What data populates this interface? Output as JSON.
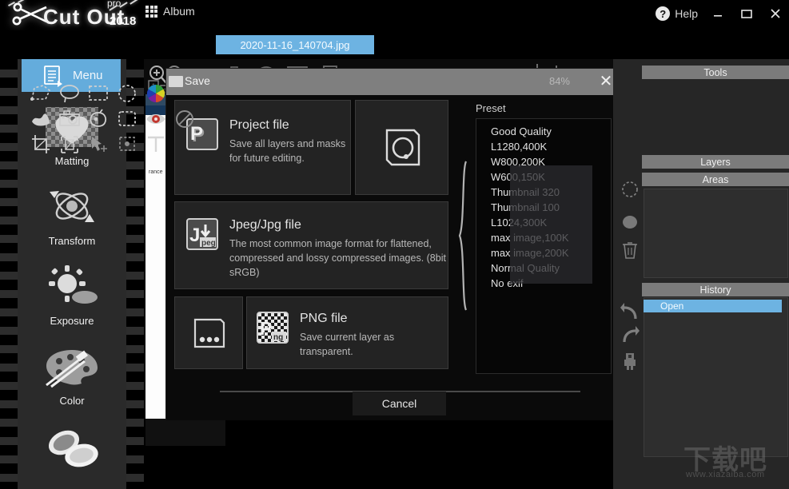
{
  "app": {
    "brand_name": "Cut Out",
    "brand_pro": "pro",
    "brand_year": "2018"
  },
  "titlebar": {
    "help_label": "Help",
    "help_glyph": "?",
    "minimize_glyph": "—",
    "maximize_glyph": "❐",
    "close_glyph": "✕"
  },
  "tabstrip": {
    "album_label": "Album",
    "open_file_tab": "2020-11-16_140704.jpg"
  },
  "sidebar": {
    "menu_label": "Menu",
    "items": [
      {
        "label": "Matting",
        "icon": "matting-icon"
      },
      {
        "label": "Transform",
        "icon": "transform-icon"
      },
      {
        "label": "Exposure",
        "icon": "exposure-icon"
      },
      {
        "label": "Color",
        "icon": "color-icon"
      },
      {
        "label": "",
        "icon": "compact-mirror-icon"
      }
    ]
  },
  "toolbar": {
    "icons": [
      "zoom-in-icon",
      "zoom-out-icon",
      "fit-1-icon",
      "fit-2-icon",
      "save-icon",
      "first-aid-icon",
      "info-icon",
      "add-image-icon",
      "print-icon"
    ]
  },
  "dialog": {
    "title": "Save",
    "zoom_level": "84%",
    "close_glyph": "✕",
    "cancel_label": "Cancel",
    "cards": [
      {
        "id": "project-file",
        "title": "Project file",
        "desc": "Save all layers and masks for future editing.",
        "icon": "project-p-icon"
      },
      {
        "id": "jpeg-file",
        "title": "Jpeg/Jpg file",
        "desc": "The most common image format for flattened, compressed and lossy compressed images. (8bit sRGB)",
        "icon": "jpeg-icon"
      },
      {
        "id": "png-file",
        "title": "PNG file",
        "desc": "Save current layer as transparent.",
        "icon": "png-icon"
      }
    ],
    "thumb_card_icon": "circle-shape-icon",
    "more_card_icon": "ellipsis-icon",
    "preset": {
      "label": "Preset",
      "items": [
        "Good Quality",
        "L1280,400K",
        "W800,200K",
        "W600,150K",
        "Thumbnail 320",
        "Thumbnail 100",
        "L1024,300K",
        "max image,100K",
        "max image,200K",
        "Normal Quality",
        "No exif"
      ]
    }
  },
  "right_panels": {
    "tools_title": "Tools",
    "layers_title": "Layers",
    "areas_title": "Areas",
    "history_title": "History",
    "history_items": [
      "Open"
    ],
    "tool_icons": [
      "polygon-lasso-icon",
      "free-lasso-icon",
      "rect-select-icon",
      "ellipse-select-icon",
      "color-wheel-icon",
      "smudge-icon",
      "camera-icon",
      "magic-wand-icon",
      "marching-ants-icon",
      "red-eye-icon",
      "none-icon",
      "crop-icon",
      "transform-box-icon",
      "move-icon",
      "spot-heal-icon",
      "text-icon"
    ],
    "side_tools": [
      "new-area-icon",
      "duplicate-area-icon",
      "delete-area-icon",
      "undo-icon",
      "redo-icon",
      "robot-icon"
    ]
  },
  "watermark": {
    "text": "下载吧",
    "url": "www.xiazaiba.com"
  },
  "colors": {
    "accent": "#6db3e2",
    "menu_accent": "#64acdc",
    "panel_header": "#7b7b7b",
    "dialog_header": "#7f7f7f",
    "card_bg": "#232323",
    "background": "#000000"
  }
}
